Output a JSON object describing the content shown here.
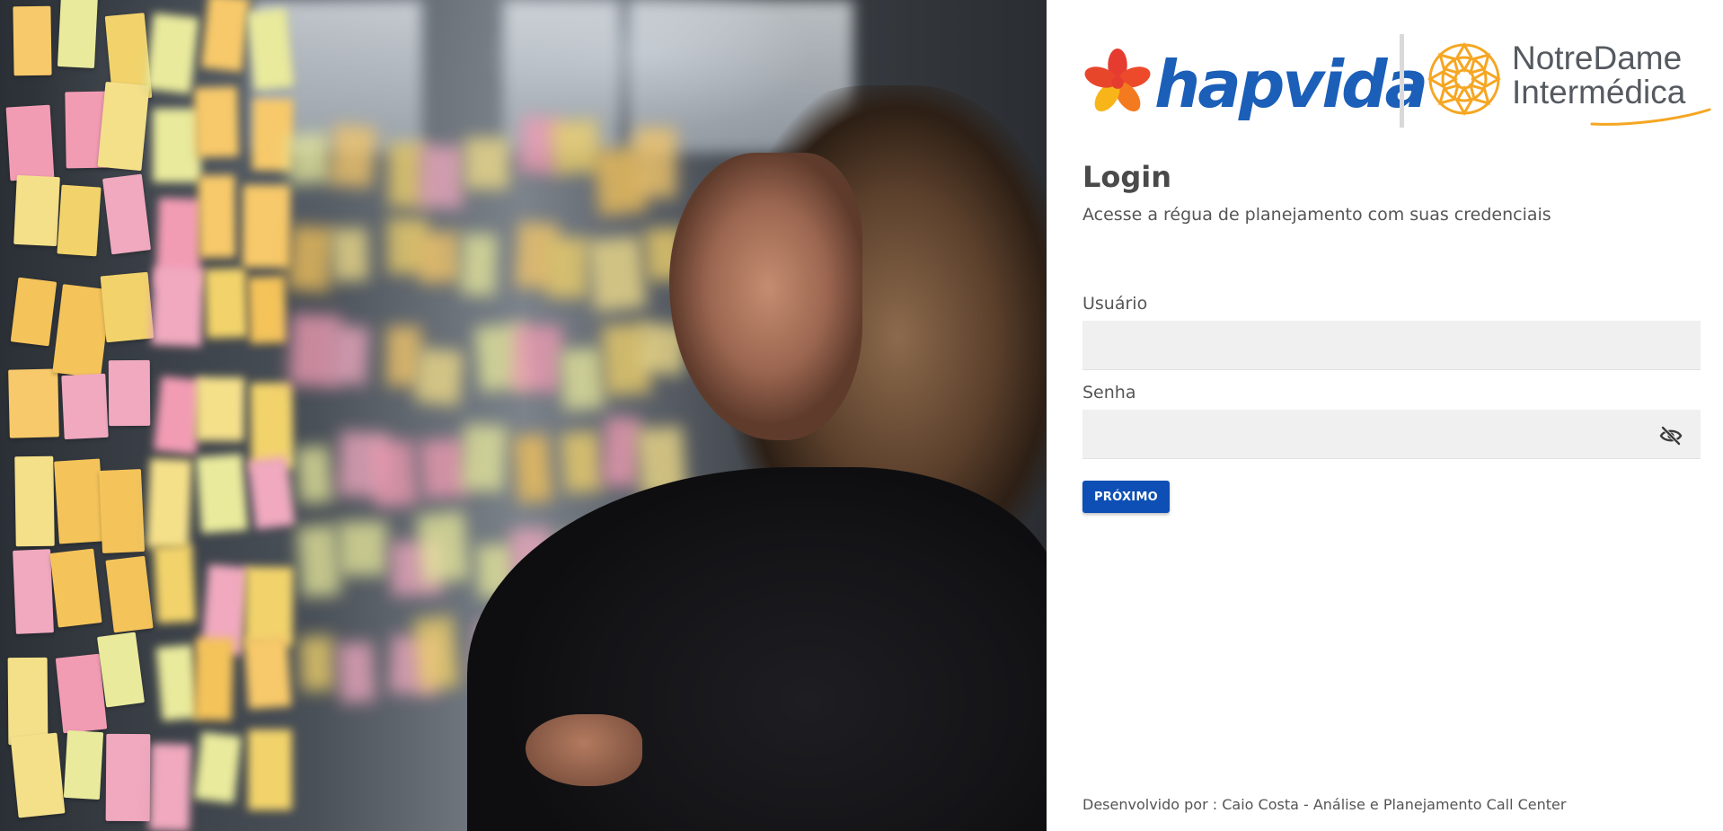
{
  "brand": {
    "hapvida_wordmark": "hapvida",
    "notredame_line1": "NotreDame",
    "notredame_line2": "Intermédica",
    "colors": {
      "hapvida_blue": "#1b5fb8",
      "hapvida_flower_red": "#e63c2f",
      "hapvida_flower_orange": "#f47a20",
      "hapvida_flower_yellow": "#f7b519",
      "notredame_orange": "#f5a623",
      "notredame_gray": "#555a60"
    }
  },
  "login": {
    "title": "Login",
    "subtitle": "Acesse a régua de planejamento com suas credenciais"
  },
  "form": {
    "user_label": "Usuário",
    "user_value": "",
    "password_label": "Senha",
    "password_value": "",
    "password_toggle_icon": "eye-off-icon",
    "next_button": "PRÓXIMO",
    "button_color": "#0d4fb5"
  },
  "footer": {
    "credit": "Desenvolvido por : Caio Costa - Análise e Planejamento Call Center"
  },
  "hero": {
    "icon": "photo-woman-sticky-notes"
  }
}
